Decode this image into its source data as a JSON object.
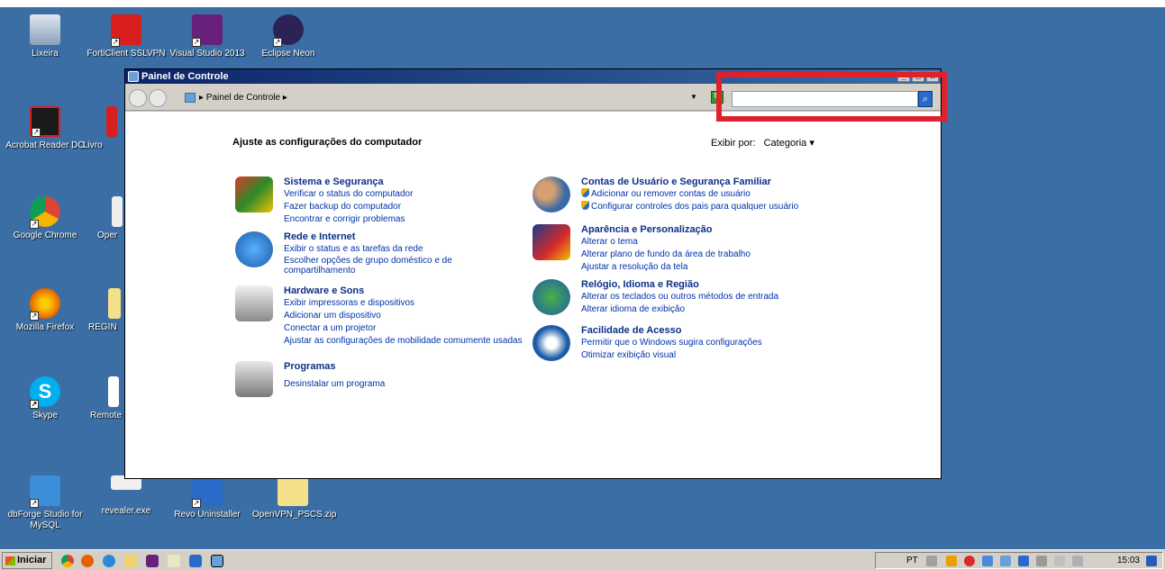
{
  "desktop": {
    "icons": [
      {
        "label": "Lixeira"
      },
      {
        "label": "FortiClient SSLVPN"
      },
      {
        "label": "Visual Studio 2013"
      },
      {
        "label": "Eclipse Neon"
      },
      {
        "label": "Acrobat Reader DC"
      },
      {
        "label": "Livro"
      },
      {
        "label": "Google Chrome"
      },
      {
        "label": "Oper"
      },
      {
        "label": "Mozilla Firefox"
      },
      {
        "label": "REGIN"
      },
      {
        "label": "Skype"
      },
      {
        "label": "Remote"
      },
      {
        "label": "dbForge Studio for MySQL"
      },
      {
        "label": "revealer.exe"
      },
      {
        "label": "Revo Uninstaller"
      },
      {
        "label": "OpenVPN_PSCS.zip"
      }
    ]
  },
  "window": {
    "title": "Painel de Controle",
    "breadcrumb": "▸ Painel de Controle ▸",
    "search_value": "",
    "heading": "Ajuste as configurações do computador",
    "view_by_label": "Exibir por:",
    "view_by_value": "Categoria ▾",
    "categories": [
      {
        "title": "Sistema e Segurança",
        "links": [
          "Verificar o status do computador",
          "Fazer backup do computador",
          "Encontrar e corrigir problemas"
        ]
      },
      {
        "title": "Rede e Internet",
        "links": [
          "Exibir o status e as tarefas da rede",
          "Escolher opções de grupo doméstico e de",
          "compartilhamento"
        ]
      },
      {
        "title": "Hardware e Sons",
        "links": [
          "Exibir impressoras e dispositivos",
          "Adicionar um dispositivo",
          "Conectar a um projetor",
          "Ajustar as configurações de mobilidade comumente usadas"
        ]
      },
      {
        "title": "Programas",
        "links": [
          "Desinstalar um programa"
        ]
      },
      {
        "title": "Contas de Usuário e Segurança Familiar",
        "links": [
          "Adicionar ou remover contas de usuário",
          "Configurar controles dos pais para qualquer usuário"
        ]
      },
      {
        "title": "Aparência e Personalização",
        "links": [
          "Alterar o tema",
          "Alterar plano de fundo da área de trabalho",
          "Ajustar a resolução da tela"
        ]
      },
      {
        "title": "Relógio, Idioma e Região",
        "links": [
          "Alterar os teclados ou outros métodos de entrada",
          "Alterar idioma de exibição"
        ]
      },
      {
        "title": "Facilidade de Acesso",
        "links": [
          "Permitir que o Windows sugira configurações",
          "Otimizar exibição visual"
        ]
      }
    ]
  },
  "taskbar": {
    "start_label": "Iniciar",
    "language": "PT",
    "clock": "15:03"
  },
  "colors": {
    "desktop": "#3a6ea5",
    "link": "#0033aa",
    "category_title": "#0c3088",
    "highlight": "#e0202a"
  }
}
